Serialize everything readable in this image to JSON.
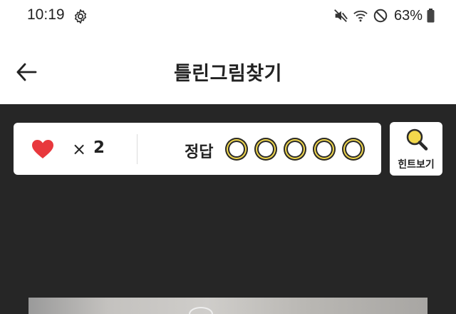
{
  "status_bar": {
    "time": "10:19",
    "battery": "63%",
    "icons": [
      "gear-icon",
      "mute-vibrate-icon",
      "wifi-icon",
      "do-not-disturb-icon",
      "battery-icon"
    ]
  },
  "header": {
    "title": "틀린그림찾기",
    "back_icon": "back-arrow-icon"
  },
  "score": {
    "heart_icon": "heart-icon",
    "times_symbol": "×",
    "lives": "2",
    "answer_label": "정답",
    "answer_slots_total": 5,
    "answer_slots_found": 0
  },
  "hint": {
    "label": "힌트보기",
    "icon": "magnifier-icon"
  },
  "colors": {
    "game_background": "#262626",
    "heart": "#e8383d",
    "accent_yellow": "#f2d84c"
  }
}
